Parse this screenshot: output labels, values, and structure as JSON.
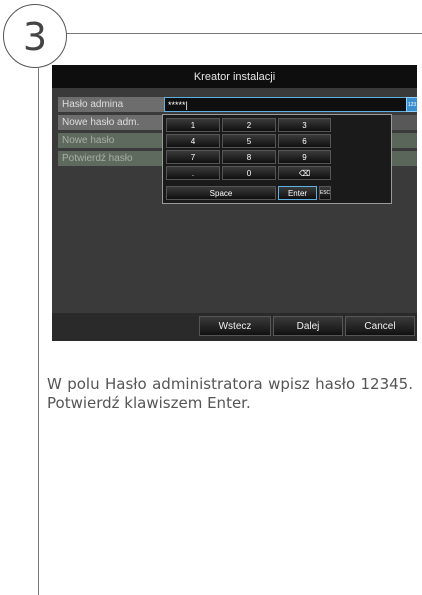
{
  "step": {
    "number": "3"
  },
  "dialog": {
    "title": "Kreator instalacji",
    "password_field": {
      "label": "Hasło admina",
      "value": "*****|"
    },
    "rows": [
      "Nowe hasło adm.",
      "Nowe hasło",
      "Potwierdź hasło"
    ],
    "keyboard_icon": "123",
    "keypad": {
      "row1": [
        "1",
        "2",
        "3"
      ],
      "row2": [
        "4",
        "5",
        "6"
      ],
      "row3": [
        "7",
        "8",
        "9"
      ],
      "row4": [
        ".",
        "0",
        "⌫"
      ],
      "space": "Space",
      "enter": "Enter",
      "esc": "ESC"
    },
    "buttons": {
      "back": "Wstecz",
      "next": "Dalej",
      "cancel": "Cancel"
    }
  },
  "instruction": "W polu Hasło administratora wpisz hasło 12345. Potwierdź klawiszem Enter.",
  "colors": {
    "accent": "#5fb0e2",
    "titlebar": "#0e0e0e",
    "dialog_bg": "#3a3a3a"
  }
}
